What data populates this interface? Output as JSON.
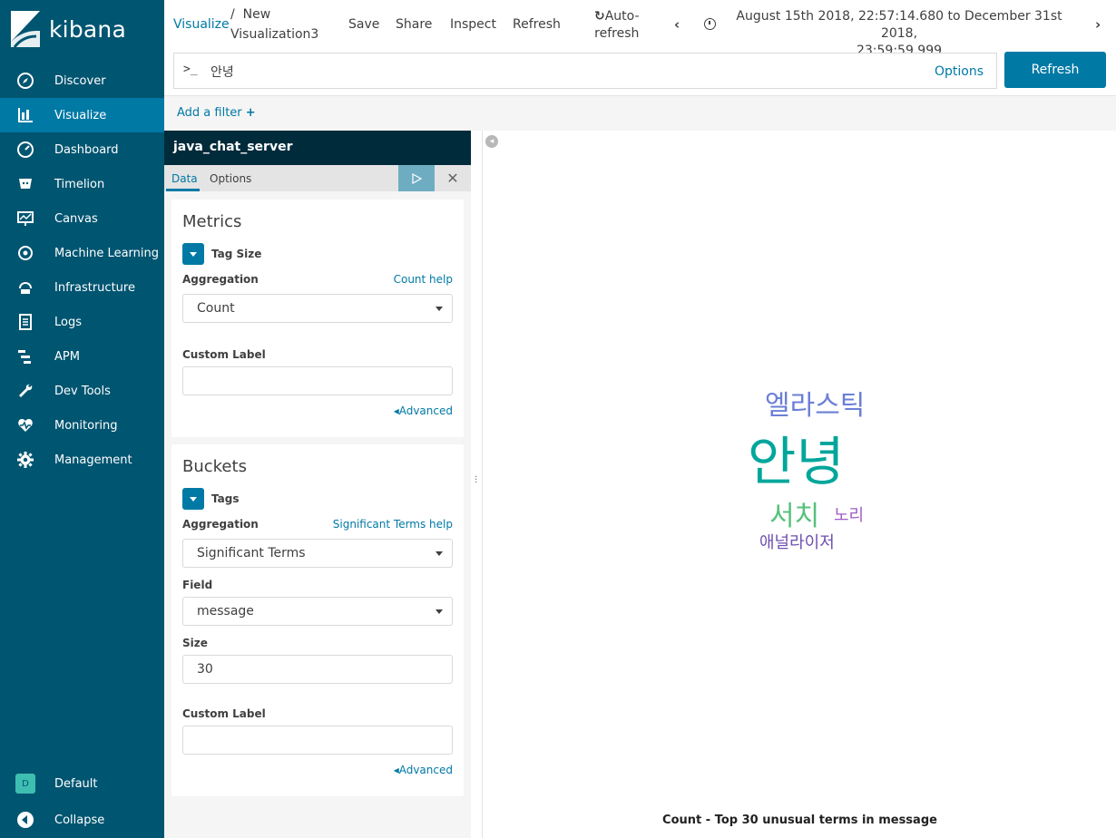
{
  "app": {
    "name": "kibana"
  },
  "sidebar": {
    "items": [
      {
        "label": "Discover",
        "icon": "compass-icon"
      },
      {
        "label": "Visualize",
        "icon": "bar-chart-icon",
        "active": true
      },
      {
        "label": "Dashboard",
        "icon": "dashboard-icon"
      },
      {
        "label": "Timelion",
        "icon": "timelion-icon"
      },
      {
        "label": "Canvas",
        "icon": "canvas-icon"
      },
      {
        "label": "Machine Learning",
        "icon": "machine-learning-icon"
      },
      {
        "label": "Infrastructure",
        "icon": "infrastructure-icon"
      },
      {
        "label": "Logs",
        "icon": "logs-icon"
      },
      {
        "label": "APM",
        "icon": "apm-icon"
      },
      {
        "label": "Dev Tools",
        "icon": "wrench-icon"
      },
      {
        "label": "Monitoring",
        "icon": "heartbeat-icon"
      },
      {
        "label": "Management",
        "icon": "gear-icon"
      }
    ],
    "space": {
      "label": "Default",
      "initial": "D"
    },
    "collapse_label": "Collapse"
  },
  "topbar": {
    "breadcrumb_root": "Visualize",
    "breadcrumb_sep": "/",
    "breadcrumb_current_line1": "New",
    "breadcrumb_current_line2": "Visualization3",
    "save": "Save",
    "share": "Share",
    "inspect": "Inspect",
    "refresh": "Refresh",
    "autorefresh_line1": "Auto-",
    "autorefresh_line2": "refresh",
    "time_range_line1": "August 15th 2018, 22:57:14.680 to December 31st 2018,",
    "time_range_line2": "23:59:59.999"
  },
  "query": {
    "prompt": ">_",
    "value": "안녕",
    "options": "Options",
    "refresh_button": "Refresh"
  },
  "filter": {
    "add_label": "Add a filter"
  },
  "editor": {
    "index_pattern": "java_chat_server",
    "tabs": [
      "Data",
      "Options"
    ],
    "metrics": {
      "title": "Metrics",
      "agg_name": "Tag Size",
      "aggregation_label": "Aggregation",
      "help": "Count help",
      "aggregation_value": "Count",
      "custom_label": "Custom Label",
      "custom_label_value": "",
      "advanced": "Advanced"
    },
    "buckets": {
      "title": "Buckets",
      "agg_name": "Tags",
      "aggregation_label": "Aggregation",
      "help": "Significant Terms help",
      "aggregation_value": "Significant Terms",
      "field_label": "Field",
      "field_value": "message",
      "size_label": "Size",
      "size_value": "30",
      "custom_label": "Custom Label",
      "custom_label_value": "",
      "advanced": "Advanced"
    }
  },
  "colors": {
    "sidebar": "#005571",
    "accent": "#0079a5",
    "word_1": "#00a69b",
    "word_2": "#6b7fd6",
    "word_3": "#57c17b",
    "word_4": "#9e5cc5",
    "word_5": "#6f4fb0"
  },
  "chart_data": {
    "type": "tagcloud",
    "words": [
      {
        "text": "안녕",
        "rank": 1
      },
      {
        "text": "엘라스틱",
        "rank": 2
      },
      {
        "text": "서치",
        "rank": 3
      },
      {
        "text": "노리",
        "rank": 4
      },
      {
        "text": "애널라이저",
        "rank": 5
      }
    ],
    "caption": "Count - Top 30 unusual terms in message"
  }
}
